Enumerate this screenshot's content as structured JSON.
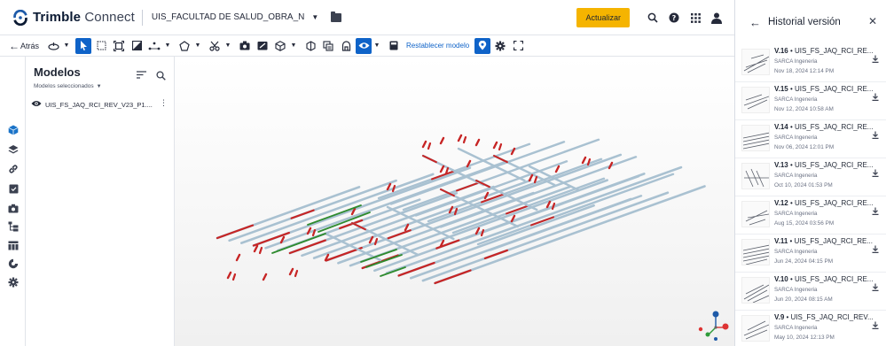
{
  "header": {
    "brand_bold": "Trimble",
    "brand_light": "Connect",
    "project_name": "UIS_FACULTAD DE SALUD_OBRA_N",
    "update_label": "Actualizar",
    "icons": [
      "search-icon",
      "help-icon",
      "apps-grid-icon",
      "user-icon"
    ]
  },
  "toolbar": {
    "back_label": "Atrás",
    "reset_label": "Restablecer modelo",
    "tools": [
      "orbit-icon",
      "select-icon",
      "box-select-icon",
      "fit-icon",
      "section-icon",
      "measure-icon",
      "shape-icon",
      "cut-icon",
      "snapshot-icon",
      "markup-icon",
      "cube-icon",
      "isolate-icon",
      "layers-icon",
      "clip-icon",
      "visibility-icon",
      "settings-icon",
      "fullscreen-icon"
    ]
  },
  "models_panel": {
    "title": "Modelos",
    "subtitle": "Modelos seleccionados",
    "model_name": "UIS_FS_JAQ_RCI_REV_V23_P1...."
  },
  "rail": [
    "cube-icon",
    "layers-icon",
    "link-icon",
    "clipboard-icon",
    "camera-icon",
    "tree-icon",
    "table-icon",
    "tag-icon",
    "gear-icon"
  ],
  "versions_panel": {
    "title": "Historial versión",
    "versions": [
      {
        "version": "V.16",
        "name": "UIS_FS_JAQ_RCI_RE...",
        "author": "SARCA Ingeneria",
        "date": "Nov 18, 2024 12:14 PM"
      },
      {
        "version": "V.15",
        "name": "UIS_FS_JAQ_RCI_RE...",
        "author": "SARCA Ingeneria",
        "date": "Nov 12, 2024 10:58 AM"
      },
      {
        "version": "V.14",
        "name": "UIS_FS_JAQ_RCI_RE...",
        "author": "SARCA Ingeneria",
        "date": "Nov 06, 2024 12:01 PM"
      },
      {
        "version": "V.13",
        "name": "UIS_FS_JAQ_RCI_RE...",
        "author": "SARCA Ingeneria",
        "date": "Oct 10, 2024 01:53 PM"
      },
      {
        "version": "V.12",
        "name": "UIS_FS_JAQ_RCI_RE...",
        "author": "SARCA Ingeneria",
        "date": "Aug 15, 2024 03:56 PM"
      },
      {
        "version": "V.11",
        "name": "UIS_FS_JAQ_RCI_RE...",
        "author": "SARCA Ingeneria",
        "date": "Jun 24, 2024 04:15 PM"
      },
      {
        "version": "V.10",
        "name": "UIS_FS_JAQ_RCI_RE...",
        "author": "SARCA Ingeneria",
        "date": "Jun 20, 2024 08:15 AM"
      },
      {
        "version": "V.9",
        "name": "UIS_FS_JAQ_RCI_REV...",
        "author": "SARCA Ingeneria",
        "date": "May 10, 2024 12:13 PM"
      }
    ]
  },
  "colors": {
    "accent": "#0f63c8",
    "update_button": "#f5b400",
    "pipe_blue": "#a9c1d1",
    "pipe_red": "#c72525",
    "pipe_green": "#2e8b2e"
  }
}
